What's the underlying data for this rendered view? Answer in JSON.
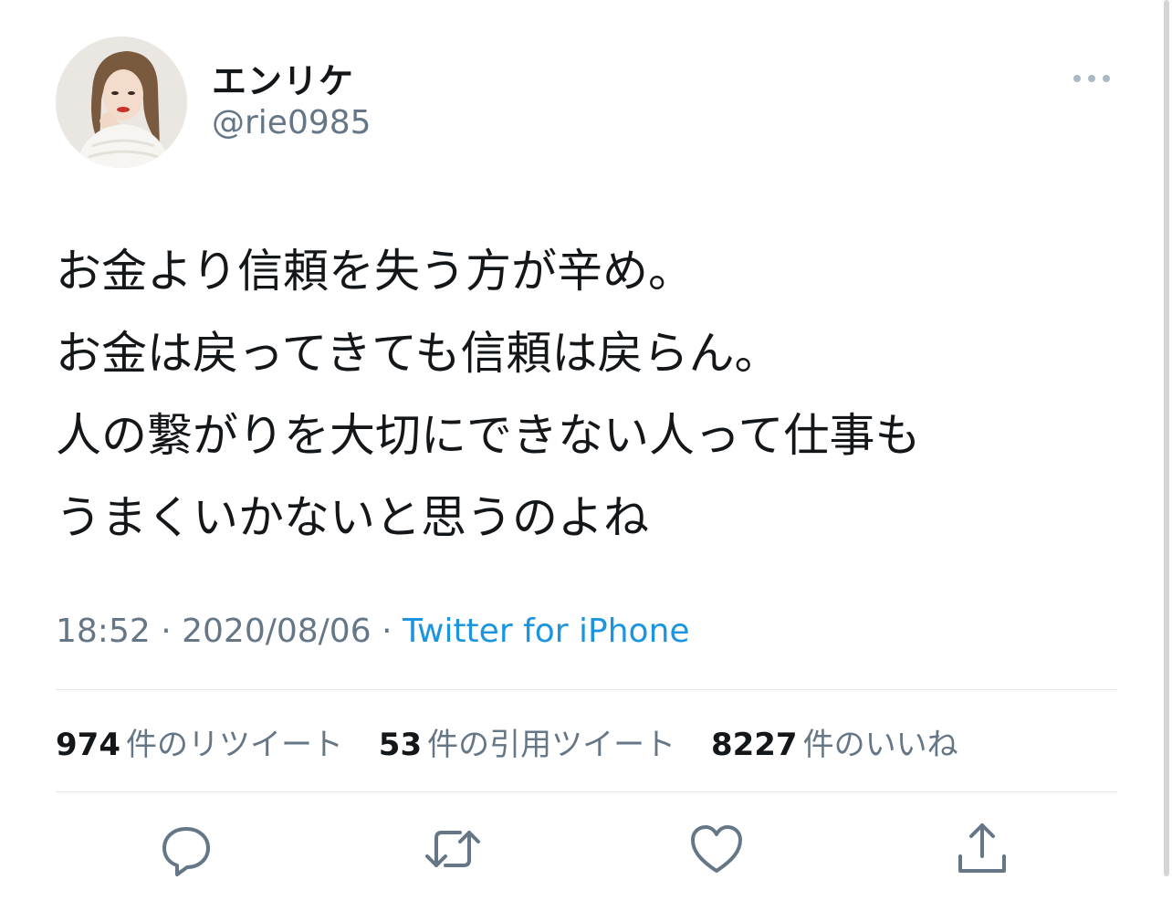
{
  "user": {
    "display_name": "エンリケ",
    "handle": "@rie0985"
  },
  "tweet": {
    "lines": [
      "お金より信頼を失う方が辛め。",
      "お金は戻ってきても信頼は戻らん。",
      "人の繋がりを大切にできない人って仕事も",
      "うまくいかないと思うのよね"
    ],
    "time": "18:52",
    "separator": "·",
    "date": "2020/08/06",
    "source": "Twitter for iPhone"
  },
  "stats": {
    "retweets": {
      "count": "974",
      "label": "件のリツイート"
    },
    "quotes": {
      "count": "53",
      "label": "件の引用ツイート"
    },
    "likes": {
      "count": "8227",
      "label": "件のいいね"
    }
  },
  "icons": {
    "more": "more-horizontal-icon",
    "reply": "reply-icon",
    "retweet": "retweet-icon",
    "like": "heart-icon",
    "share": "share-icon"
  },
  "colors": {
    "text": "#14171a",
    "secondary": "#657786",
    "link": "#1b95e0",
    "divider": "#e1e8ed"
  }
}
